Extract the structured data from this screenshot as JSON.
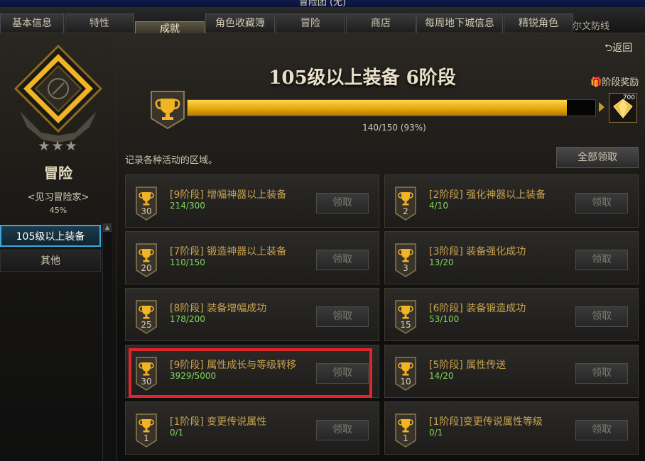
{
  "window": {
    "title": "冒险团 (无)"
  },
  "tabs": [
    {
      "label": "基本信息",
      "active": false
    },
    {
      "label": "特性",
      "active": false
    },
    {
      "label": "成就",
      "active": true
    },
    {
      "label": "角色收藏簿",
      "active": false
    },
    {
      "label": "冒险",
      "active": false
    },
    {
      "label": "商店",
      "active": false
    },
    {
      "label": "每周地下城信息",
      "active": false
    },
    {
      "label": "精锐角色",
      "active": false
    }
  ],
  "tab_overflow_text": "尔文防线",
  "rank": {
    "stars": "★★★",
    "title": "冒险",
    "subtitle": "<见习冒险家>",
    "percent": "45%"
  },
  "categories": [
    {
      "label": "105级以上装备",
      "active": true
    },
    {
      "label": "其他",
      "active": false
    }
  ],
  "header": {
    "back_label": "返回",
    "stage_title": "105级以上装备 6阶段",
    "reward_label": "阶段奖励",
    "progress_text": "140/150 (93%)",
    "progress_fraction": 0.93,
    "reward_count": "700",
    "description": "记录各种活动的区域。",
    "claim_all_label": "全部领取"
  },
  "achievements": [
    {
      "stage": "[9阶段] 增幅神器以上装备",
      "progress": "214/300",
      "badge": "30",
      "claim": "领取"
    },
    {
      "stage": "[2阶段] 强化神器以上装备",
      "progress": "4/10",
      "badge": "2",
      "claim": "领取"
    },
    {
      "stage": "[7阶段] 锻造神器以上装备",
      "progress": "110/150",
      "badge": "20",
      "claim": "领取"
    },
    {
      "stage": "[3阶段] 装备强化成功",
      "progress": "13/20",
      "badge": "3",
      "claim": "领取"
    },
    {
      "stage": "[8阶段] 装备增幅成功",
      "progress": "178/200",
      "badge": "25",
      "claim": "领取"
    },
    {
      "stage": "[6阶段] 装备锻造成功",
      "progress": "53/100",
      "badge": "15",
      "claim": "领取"
    },
    {
      "stage": "[9阶段] 属性成长与等级转移",
      "progress": "3929/5000",
      "badge": "30",
      "claim": "领取"
    },
    {
      "stage": "[5阶段] 属性传送",
      "progress": "14/20",
      "badge": "10",
      "claim": "领取"
    },
    {
      "stage": "[1阶段] 变更传说属性",
      "progress": "0/1",
      "badge": "1",
      "claim": "领取"
    },
    {
      "stage": "[1阶段]变更传说属性等级",
      "progress": "0/1",
      "badge": "1",
      "claim": "领取"
    }
  ],
  "colors": {
    "accent_gold": "#e2a40a",
    "progress_green": "#7fd65a",
    "title_gold": "#c8a24e",
    "highlight_red": "#e0262b",
    "active_category_border": "#3fa6d8"
  }
}
